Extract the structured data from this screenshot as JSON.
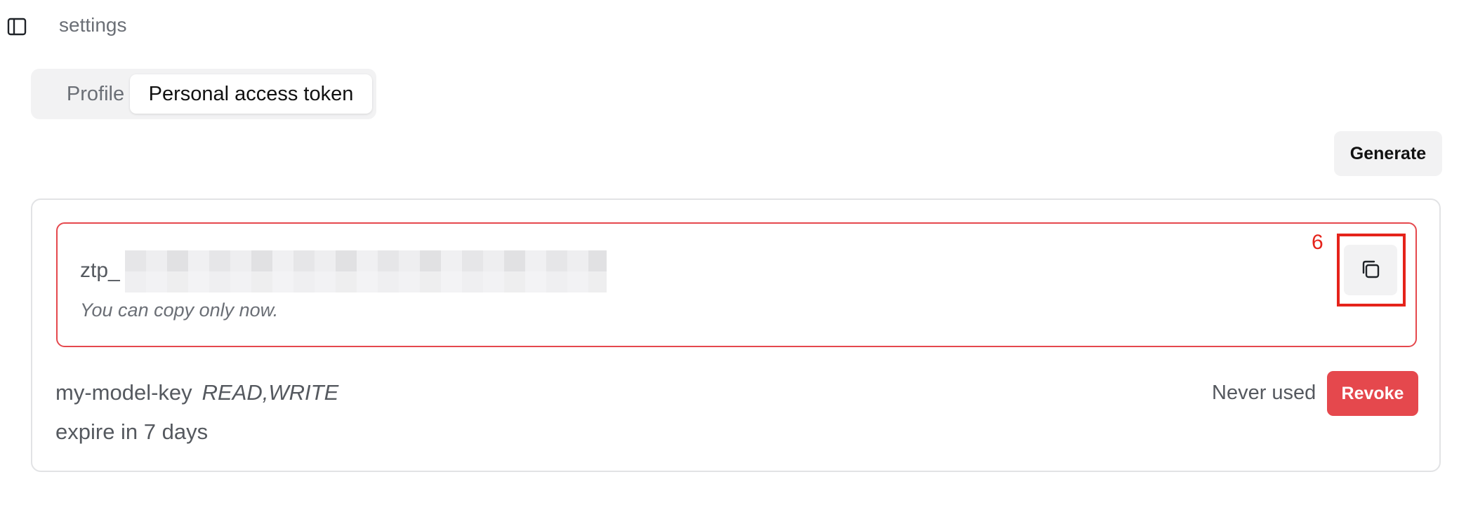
{
  "header": {
    "title": "settings",
    "toggle_icon": "sidebar-toggle-icon"
  },
  "tabs": [
    {
      "label": "Profile",
      "active": false
    },
    {
      "label": "Personal access token",
      "active": true
    }
  ],
  "toolbar": {
    "generate_label": "Generate"
  },
  "new_token": {
    "prefix": "ztp_",
    "hint": "You can copy only now.",
    "copy_icon": "copy-icon",
    "annotation": "6"
  },
  "token": {
    "name": "my-model-key",
    "scopes": "READ,WRITE",
    "expire": "expire in 7 days",
    "last_used": "Never used",
    "revoke_label": "Revoke"
  },
  "colors": {
    "danger": "#e5484d",
    "annotation": "#e5231b",
    "muted": "#6b6f76"
  }
}
